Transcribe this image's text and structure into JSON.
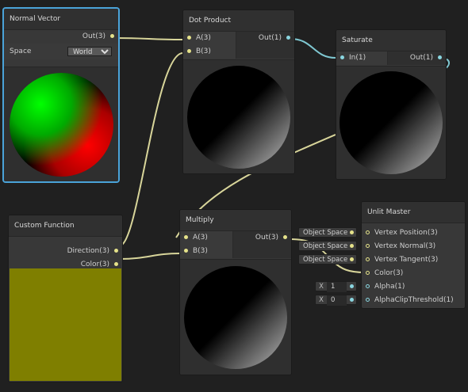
{
  "colors": {
    "vector3_port": "#e5e28a",
    "vector1_port": "#8ad6e0",
    "selection": "#4aa3d9",
    "custom_preview": "#7f7f00"
  },
  "nodes": {
    "normal_vector": {
      "title": "Normal Vector",
      "out": "Out(3)",
      "space_label": "Space",
      "space_value": "World"
    },
    "dot_product": {
      "title": "Dot Product",
      "in_a": "A(3)",
      "in_b": "B(3)",
      "out": "Out(1)"
    },
    "saturate": {
      "title": "Saturate",
      "in": "In(1)",
      "out": "Out(1)"
    },
    "custom_function": {
      "title": "Custom Function",
      "out_direction": "Direction(3)",
      "out_color": "Color(3)"
    },
    "multiply": {
      "title": "Multiply",
      "in_a": "A(3)",
      "in_b": "B(3)",
      "out": "Out(3)"
    },
    "unlit_master": {
      "title": "Unlit Master",
      "ports": [
        "Vertex Position(3)",
        "Vertex Normal(3)",
        "Vertex Tangent(3)",
        "Color(3)",
        "Alpha(1)",
        "AlphaClipThreshold(1)"
      ],
      "space_chips": [
        "Object Space",
        "Object Space",
        "Object Space"
      ],
      "alpha": {
        "axis": "X",
        "value": "1"
      },
      "clip": {
        "axis": "X",
        "value": "0"
      }
    }
  }
}
